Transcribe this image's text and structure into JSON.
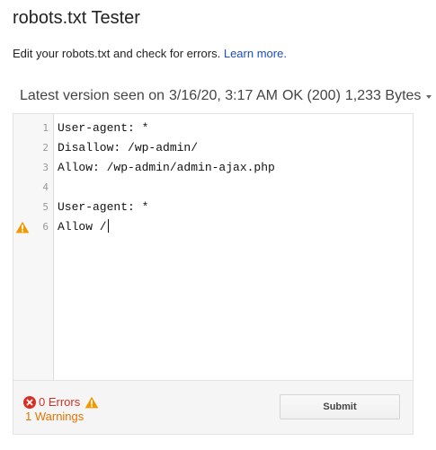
{
  "page": {
    "title": "robots.txt Tester",
    "description": "Edit your robots.txt and check for errors.",
    "learn_more": "Learn more."
  },
  "version": {
    "prefix": "Latest version seen on",
    "date": "3/16/20, 3:17 AM",
    "status": "OK (200)",
    "size": "1,233 Bytes"
  },
  "editor": {
    "lines": [
      {
        "num": "1",
        "text": "User-agent: *",
        "warning": false
      },
      {
        "num": "2",
        "text": "Disallow: /wp-admin/",
        "warning": false
      },
      {
        "num": "3",
        "text": "Allow: /wp-admin/admin-ajax.php",
        "warning": false
      },
      {
        "num": "4",
        "text": "",
        "warning": false
      },
      {
        "num": "5",
        "text": "User-agent: *",
        "warning": false
      },
      {
        "num": "6",
        "text": "Allow /",
        "warning": true
      }
    ]
  },
  "footer": {
    "errors": "0 Errors",
    "warnings": "1 Warnings",
    "submit": "Submit"
  },
  "colors": {
    "error": "#d93025",
    "warning": "#e37400",
    "warning_icon": "#f29900",
    "link": "#1a4cc5"
  },
  "icons": {
    "error": "error-circle-icon",
    "warning": "warning-triangle-icon",
    "dropdown": "caret-down-icon"
  }
}
